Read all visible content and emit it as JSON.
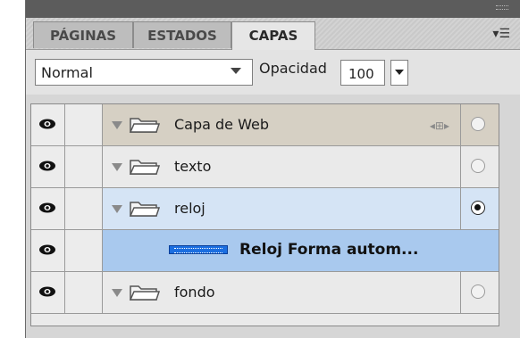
{
  "tabs": [
    {
      "label": "PÁGINAS",
      "active": false
    },
    {
      "label": "ESTADOS",
      "active": false
    },
    {
      "label": "CAPAS",
      "active": true
    }
  ],
  "controls": {
    "blend_mode": "Normal",
    "opacity_label": "Opacidad",
    "opacity_value": "100"
  },
  "layers": [
    {
      "name": "Capa de Web",
      "type": "folder",
      "expanded": true,
      "selected": false,
      "target": "empty"
    },
    {
      "name": "texto",
      "type": "folder",
      "expanded": true,
      "selected": false,
      "target": "empty"
    },
    {
      "name": "reloj",
      "type": "folder",
      "expanded": true,
      "selected": true,
      "target": "filled"
    },
    {
      "name": "Reloj Forma autom...",
      "type": "object",
      "highlighted": true
    },
    {
      "name": "fondo",
      "type": "folder",
      "expanded": true,
      "selected": false,
      "target": "empty"
    }
  ],
  "colors": {
    "selected_row": "#d5e4f5",
    "highlighted_row": "#a9c9ee",
    "web_layer_row": "#d6d0c4"
  }
}
